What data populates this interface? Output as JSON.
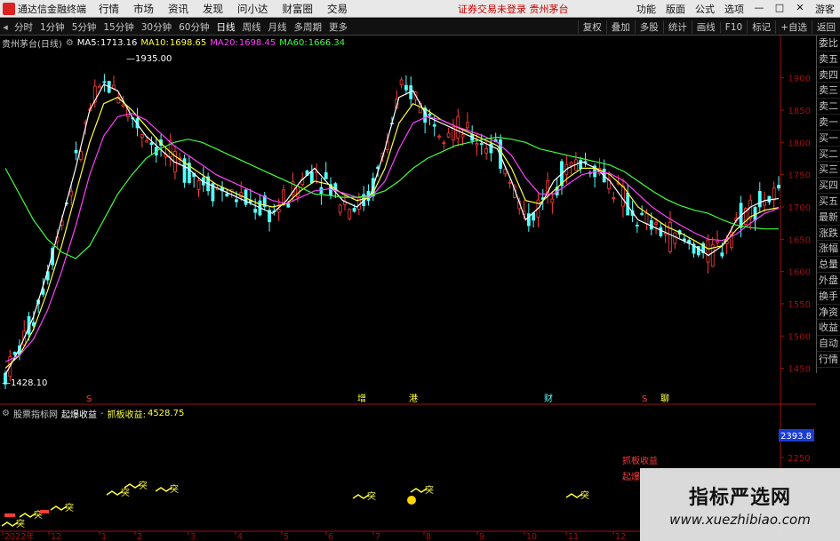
{
  "menubar": {
    "app_title": "通达信金融终端",
    "menus": [
      "行情",
      "市场",
      "资讯",
      "发现",
      "问小达",
      "财富圈",
      "交易"
    ],
    "center_notice": "证券交易未登录  贵州茅台",
    "right_items": [
      "功能",
      "版面",
      "公式",
      "选项"
    ],
    "window_controls": [
      "—",
      "□",
      "✕"
    ],
    "login": "游客"
  },
  "toolbar": {
    "periods": [
      "分时",
      "1分钟",
      "5分钟",
      "15分钟",
      "30分钟",
      "60分钟",
      "日线",
      "周线",
      "月线",
      "多周期",
      "更多"
    ],
    "active_period": "日线",
    "tools": [
      "复权",
      "叠加",
      "多股",
      "统计",
      "画线",
      "F10",
      "标记",
      "+自选",
      "返回"
    ]
  },
  "info": {
    "stock": "贵州茅台(日线)",
    "ma5_label": "MA5:",
    "ma5": "1713.16",
    "ma10_label": "MA10:",
    "ma10": "1698.65",
    "ma20_label": "MA20:",
    "ma20": "1698.45",
    "ma60_label": "MA60:",
    "ma60": "1666.34"
  },
  "colors": {
    "up": "#ff3b3b",
    "down": "#54ffff",
    "ma5": "#ffffff",
    "ma10": "#ffff40",
    "ma20": "#ff40ff",
    "ma60": "#40ff40",
    "axis": "#a01010",
    "grid": "#5a0808",
    "text_ui": "#c8c8c8"
  },
  "chart_data": {
    "type": "line",
    "title": "贵州茅台(日线)",
    "y_ticks": [
      1900,
      1850,
      1800,
      1750,
      1700,
      1650,
      1600,
      1550,
      1500,
      1450
    ],
    "ylim": [
      1415,
      1945
    ],
    "annotations": {
      "high": "1935.00",
      "low": "1428.10"
    },
    "series": [
      {
        "name": "MA5",
        "values": [
          1440,
          1480,
          1530,
          1600,
          1680,
          1760,
          1850,
          1890,
          1880,
          1840,
          1810,
          1790,
          1770,
          1760,
          1740,
          1730,
          1720,
          1710,
          1700,
          1690,
          1710,
          1740,
          1760,
          1735,
          1710,
          1700,
          1720,
          1790,
          1870,
          1880,
          1840,
          1830,
          1820,
          1810,
          1800,
          1790,
          1740,
          1680,
          1700,
          1740,
          1760,
          1770,
          1760,
          1740,
          1710,
          1680,
          1670,
          1660,
          1650,
          1640,
          1625,
          1640,
          1680,
          1700,
          1710,
          1713
        ]
      },
      {
        "name": "MA10",
        "values": [
          1450,
          1470,
          1510,
          1570,
          1640,
          1720,
          1800,
          1860,
          1870,
          1850,
          1825,
          1800,
          1780,
          1765,
          1750,
          1735,
          1725,
          1715,
          1705,
          1700,
          1705,
          1725,
          1740,
          1735,
          1720,
          1710,
          1715,
          1760,
          1830,
          1860,
          1850,
          1835,
          1825,
          1815,
          1805,
          1795,
          1760,
          1710,
          1705,
          1725,
          1745,
          1760,
          1760,
          1750,
          1730,
          1700,
          1685,
          1670,
          1660,
          1648,
          1635,
          1640,
          1665,
          1685,
          1695,
          1699
        ]
      },
      {
        "name": "MA20",
        "values": [
          1460,
          1470,
          1495,
          1540,
          1600,
          1670,
          1750,
          1810,
          1840,
          1845,
          1835,
          1815,
          1795,
          1780,
          1765,
          1750,
          1740,
          1730,
          1720,
          1710,
          1705,
          1715,
          1725,
          1728,
          1722,
          1715,
          1715,
          1740,
          1790,
          1830,
          1840,
          1835,
          1825,
          1818,
          1810,
          1800,
          1780,
          1745,
          1720,
          1720,
          1735,
          1750,
          1755,
          1752,
          1740,
          1720,
          1700,
          1685,
          1672,
          1660,
          1650,
          1648,
          1658,
          1675,
          1690,
          1698
        ]
      },
      {
        "name": "MA60",
        "values": [
          1760,
          1720,
          1680,
          1650,
          1630,
          1620,
          1640,
          1680,
          1720,
          1750,
          1775,
          1790,
          1800,
          1805,
          1800,
          1790,
          1780,
          1770,
          1760,
          1750,
          1740,
          1730,
          1720,
          1718,
          1715,
          1715,
          1718,
          1725,
          1740,
          1760,
          1775,
          1785,
          1795,
          1800,
          1805,
          1808,
          1805,
          1800,
          1790,
          1785,
          1780,
          1775,
          1770,
          1765,
          1755,
          1740,
          1725,
          1712,
          1702,
          1695,
          1690,
          1680,
          1672,
          1668,
          1666,
          1666
        ]
      }
    ],
    "markers": [
      "S",
      "增",
      "S",
      "港",
      "财",
      "S",
      "聊"
    ],
    "x_ticks": [
      "2022年",
      "12",
      "1",
      "2",
      "3",
      "4",
      "5",
      "6",
      "7",
      "8",
      "9",
      "10",
      "11",
      "12"
    ]
  },
  "indicator": {
    "label": "股票指标网",
    "name": "起爆收益",
    "sep": "-",
    "value_label": "抓板收益:",
    "value": "4528.75",
    "axis_value": "2393.8",
    "axis_tick": "2250",
    "legend1": "抓板收益",
    "legend2": "起爆",
    "tags": [
      "突",
      "突",
      "突",
      "突",
      "突",
      "突",
      "突",
      "突"
    ]
  },
  "sidepanel": {
    "items": [
      "委比",
      "卖五",
      "卖四",
      "卖三",
      "卖二",
      "卖一",
      "买一",
      "买二",
      "买三",
      "买四",
      "买五",
      "最新",
      "涨跌",
      "涨幅",
      "总量",
      "外盘",
      "换手",
      "净资",
      "收益",
      "自动",
      "行情"
    ]
  },
  "watermark": {
    "title": "指标严选网",
    "url": "www.xuezhibiao.com"
  }
}
